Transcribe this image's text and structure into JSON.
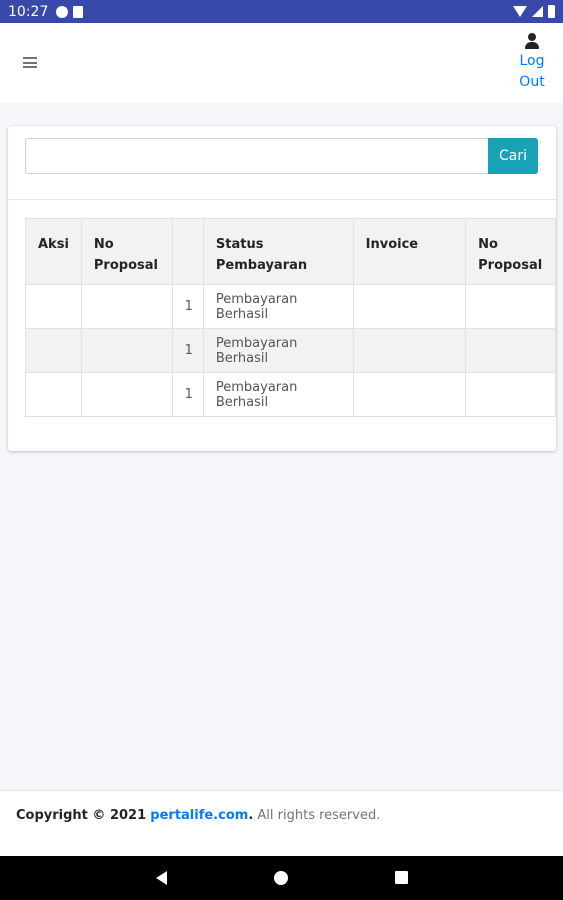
{
  "status_bar": {
    "time": "10:27",
    "icons": [
      "notification-icon",
      "sd-card-icon",
      "wifi-icon",
      "signal-icon",
      "battery-icon"
    ]
  },
  "header": {
    "menu_icon": "hamburger-icon",
    "logout_label_line1": "Log",
    "logout_label_line2": "Out",
    "user_icon": "user-icon"
  },
  "search": {
    "placeholder": "",
    "value": "",
    "button_label": "Cari"
  },
  "table": {
    "columns": [
      "Aksi",
      "No Proposal",
      "",
      "Status Pembayaran",
      "Invoice",
      "No Proposal"
    ],
    "rows": [
      {
        "aksi": "",
        "no_proposal": "",
        "count": "1",
        "status": "Pembayaran Berhasil",
        "invoice": "",
        "no_proposal_2": ""
      },
      {
        "aksi": "",
        "no_proposal": "",
        "count": "1",
        "status": "Pembayaran Berhasil",
        "invoice": "",
        "no_proposal_2": ""
      },
      {
        "aksi": "",
        "no_proposal": "",
        "count": "1",
        "status": "Pembayaran Berhasil",
        "invoice": "",
        "no_proposal_2": ""
      }
    ]
  },
  "footer": {
    "copyright_prefix": "Copyright © 2021",
    "site_link": "pertalife.com",
    "suffix": "All rights reserved."
  },
  "colors": {
    "status_bar": "#3949ab",
    "accent_button": "#17a2b8",
    "link": "#007bff",
    "background": "#f4f6f9"
  }
}
